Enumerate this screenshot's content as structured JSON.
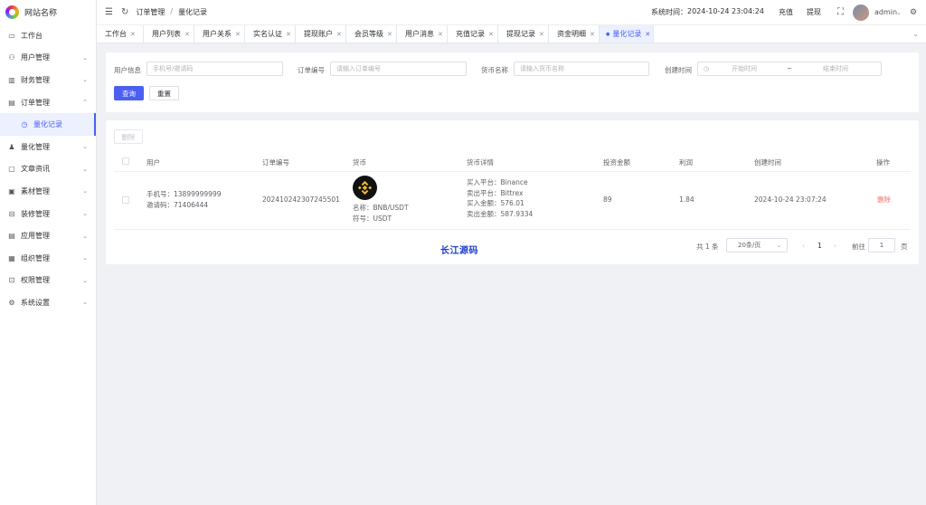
{
  "app": {
    "title": "网站名称"
  },
  "sidebar": {
    "items": [
      {
        "label": "工作台",
        "icon": "monitor-icon",
        "glyph": "▭"
      },
      {
        "label": "用户管理",
        "icon": "user-icon",
        "glyph": "⚇"
      },
      {
        "label": "财务管理",
        "icon": "chart-icon",
        "glyph": "▥"
      },
      {
        "label": "订单管理",
        "icon": "order-icon",
        "glyph": "▤"
      },
      {
        "label": "量化记录",
        "icon": "clock-icon",
        "glyph": "◷"
      },
      {
        "label": "量化管理",
        "icon": "robot-icon",
        "glyph": "♟"
      },
      {
        "label": "文章资讯",
        "icon": "message-icon",
        "glyph": "▢"
      },
      {
        "label": "素材管理",
        "icon": "picture-icon",
        "glyph": "▣"
      },
      {
        "label": "装修管理",
        "icon": "brush-icon",
        "glyph": "⊟"
      },
      {
        "label": "应用管理",
        "icon": "app-icon",
        "glyph": "▤"
      },
      {
        "label": "组织管理",
        "icon": "briefcase-icon",
        "glyph": "▦"
      },
      {
        "label": "权限管理",
        "icon": "lock-icon",
        "glyph": "⊡"
      },
      {
        "label": "系统设置",
        "icon": "gear-icon",
        "glyph": "⚙"
      }
    ]
  },
  "header": {
    "breadcrumb": [
      "订单管理",
      "量化记录"
    ],
    "system_time_label": "系统时间：",
    "system_time": "2024-10-24 23:04:24",
    "recharge": "充值",
    "withdraw": "提现",
    "username": "admin"
  },
  "tabs": [
    "工作台",
    "用户列表",
    "用户关系",
    "实名认证",
    "提现账户",
    "会员等级",
    "用户消息",
    "充值记录",
    "提现记录",
    "资金明细",
    "量化记录"
  ],
  "filters": {
    "user_info_label": "用户信息",
    "user_info_placeholder": "手机号/邀请码",
    "order_no_label": "订单编号",
    "order_no_placeholder": "请输入订单编号",
    "coin_label": "货币名称",
    "coin_placeholder": "请输入货币名称",
    "created_label": "创建时间",
    "start_placeholder": "开始时间",
    "range_sep": "~",
    "end_placeholder": "结束时间",
    "search_btn": "查询",
    "reset_btn": "重置"
  },
  "table": {
    "delete_btn": "删除",
    "columns": [
      "用户",
      "订单编号",
      "货币",
      "货币详情",
      "投资金额",
      "利润",
      "创建时间",
      "操作"
    ],
    "row": {
      "phone": "手机号：13899999999",
      "invite": "邀请码：71406444",
      "order_no": "202410242307245501",
      "coin_name": "名称：BNB/USDT",
      "coin_symbol": "符号：USDT",
      "buy_platform": "买入平台：Binance",
      "sell_platform": "卖出平台：Bittrex",
      "buy_amount": "买入金额：576.01",
      "sell_amount": "卖出金额：587.9334",
      "invest": "89",
      "profit": "1.84",
      "created": "2024-10-24 23:07:24",
      "action": "删除"
    },
    "watermark": "长江源码"
  },
  "pagination": {
    "total": "共 1 条",
    "page_size": "20条/页",
    "current": "1",
    "goto_label": "前往",
    "goto_value": "1",
    "page_unit": "页"
  },
  "colors": {
    "primary": "#4b60f0",
    "danger": "#f56c6c",
    "watermark": "#1e3fd0"
  }
}
